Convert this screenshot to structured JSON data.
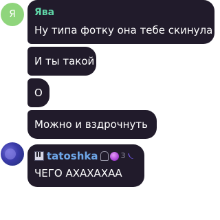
{
  "messages": [
    {
      "sender": "Ява",
      "avatar_initial": "Я",
      "avatar_color": "#8fd57c",
      "name_color": "#5fd4a6",
      "texts": [
        "Ну типа фотку она тебе скинула",
        "И ты такой",
        "О",
        "Можно и вздрочнуть"
      ]
    },
    {
      "sender": "tatoshka",
      "name_color": "#6ea6e8",
      "sender_icons": [
        "piano-icon",
        "ghost-icon",
        "crystal-ball-icon",
        "small-glyph-icon",
        "swirl-icon"
      ],
      "small_glyph": "3",
      "swirl_glyph": "᭥",
      "texts": [
        "ЧЕГО АХАХАХАА"
      ]
    }
  ],
  "colors": {
    "bubble_bg": "#211b2b",
    "text": "#ffffff",
    "page_bg": "#ffffff"
  }
}
